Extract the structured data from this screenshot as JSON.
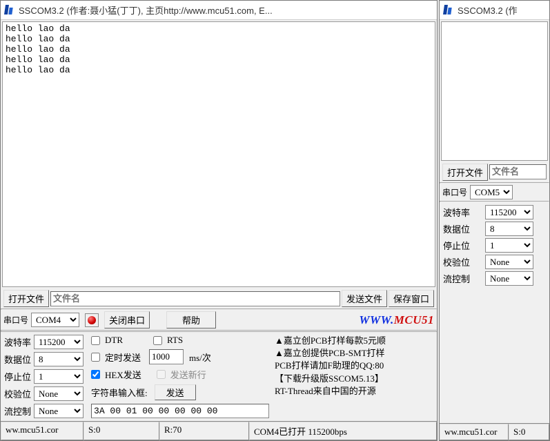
{
  "win1": {
    "title": "SSCOM3.2 (作者:聂小猛(丁丁), 主页http://www.mcu51.com,  E...",
    "log": "hello lao da\nhello lao da\nhello lao da\nhello lao da\nhello lao da",
    "row1": {
      "open_file": "打开文件",
      "filename_placeholder": "文件名",
      "send_file": "发送文件",
      "save_window": "保存窗口"
    },
    "row2": {
      "com_label": "串口号",
      "com_value": "COM4",
      "close_port": "关闭串口",
      "help": "帮助",
      "link_www": "WWW.",
      "link_mcu": "MCU51"
    },
    "settings": {
      "baud_label": "波特率",
      "baud_value": "115200",
      "data_label": "数据位",
      "data_value": "8",
      "stop_label": "停止位",
      "stop_value": "1",
      "parity_label": "校验位",
      "parity_value": "None",
      "flow_label": "流控制",
      "flow_value": "None"
    },
    "mid": {
      "dtr": "DTR",
      "rts": "RTS",
      "timed_send": "定时发送",
      "interval": "1000",
      "interval_unit": "ms/次",
      "hex_send": "HEX发送",
      "send_newline": "发送新行",
      "input_label": "字符串输入框:",
      "send_btn": "发送",
      "input_value": "3A 00 01 00 00 00 00 00"
    },
    "ads": {
      "l1": "▲嘉立创PCB打样每款5元顺",
      "l2": "▲嘉立创提供PCB-SMT打样",
      "l3": "PCB打样请加F助理的QQ:80",
      "l4": "【下载升级版SSCOM5.13】",
      "l5": "RT-Thread来自中国的开源"
    },
    "status": {
      "url": "ww.mcu51.cor",
      "s": "S:0",
      "r": "R:70",
      "port": "COM4已打开  115200bps"
    }
  },
  "win2": {
    "title": "SSCOM3.2 (作",
    "row1": {
      "open_file": "打开文件",
      "filename_placeholder": "文件名"
    },
    "row2": {
      "com_label": "串口号",
      "com_value": "COM5"
    },
    "settings": {
      "baud_label": "波特率",
      "baud_value": "115200",
      "data_label": "数据位",
      "data_value": "8",
      "stop_label": "停止位",
      "stop_value": "1",
      "parity_label": "校验位",
      "parity_value": "None",
      "flow_label": "流控制",
      "flow_value": "None"
    },
    "status": {
      "url": "ww.mcu51.cor",
      "s": "S:0"
    }
  }
}
